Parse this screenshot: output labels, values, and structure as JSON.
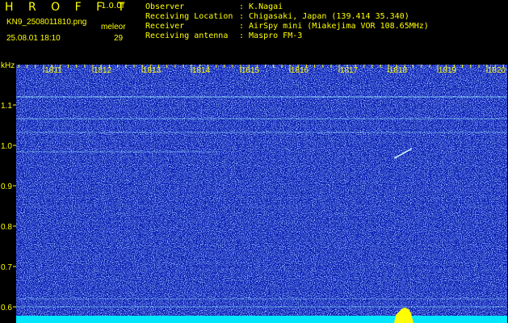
{
  "header": {
    "title": "H R O F F T",
    "version": "1.0.0f",
    "filename": "KN9_2508011810.png",
    "datetime": "25.08.01 18:10",
    "meteor_label": "meleor",
    "meteor_count": "29",
    "meta": [
      {
        "key": "Observer",
        "value": ": K.Nagai"
      },
      {
        "key": "Receiving Location",
        "value": ": Chigasaki, Japan (139.414 35.340)"
      },
      {
        "key": "Receiver",
        "value": ": AirSpy mini (Miakejima VOR 108.65MHz)"
      },
      {
        "key": "Receiving antenna",
        "value": ": Maspro FM-3"
      }
    ]
  },
  "spectrogram": {
    "y_unit": "kHz",
    "y_ticks": [
      "1.1",
      "1.0",
      "0.9",
      "0.8",
      "0.7",
      "0.6"
    ],
    "x_ticks": [
      "1811",
      "1812",
      "1813",
      "1814",
      "1815",
      "1816",
      "1817",
      "1818",
      "1819",
      "1820"
    ],
    "colors": {
      "background": "#0a1eb4",
      "noise": "#5a8cff",
      "signal": "#9ff0ff",
      "lower_band": "#00e6ff",
      "burst": "#ffff00",
      "labels": "#ffff00"
    }
  }
}
